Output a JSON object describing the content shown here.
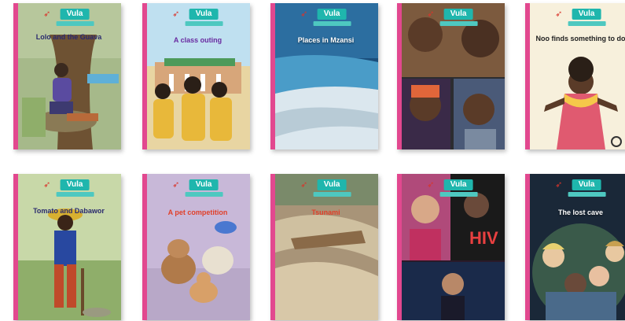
{
  "brand": {
    "name": "Vula",
    "logo_colors": {
      "badge": "#1fb6ad",
      "bird": "#d9342b",
      "spine": "#e2488f"
    }
  },
  "books": [
    {
      "title": "Lolo and the Guava"
    },
    {
      "title": "A class outing"
    },
    {
      "title": "Places in Mzansi"
    },
    {
      "title": ""
    },
    {
      "title": "Noo finds something to do"
    },
    {
      "title": "Tomato and Dabawor"
    },
    {
      "title": "A pet competition"
    },
    {
      "title": "Tsunami"
    },
    {
      "title": "HIV"
    },
    {
      "title": "The lost cave"
    }
  ]
}
